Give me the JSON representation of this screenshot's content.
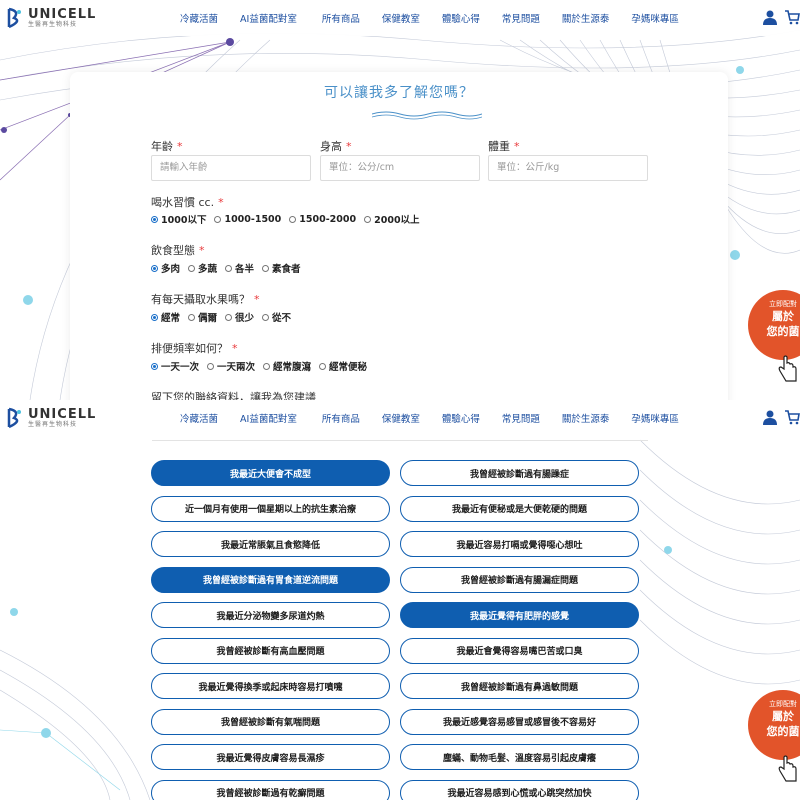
{
  "header": {
    "logo_name": "UNICELL",
    "logo_sub": "生醫再生物科技",
    "nav": [
      "冷藏活菌",
      "AI益菌配對室",
      "所有商品",
      "保健教室",
      "體驗心得",
      "常見問題",
      "關於生源泰",
      "孕媽咪專區"
    ]
  },
  "form": {
    "title": "可以讓我多了解您嗎？",
    "age_label": "年齡",
    "age_placeholder": "請輸入年齡",
    "height_label": "身高",
    "height_placeholder": "單位：公分/cm",
    "weight_label": "體重",
    "weight_placeholder": "單位：公斤/kg",
    "water_label": "喝水習慣 cc.",
    "water_options": [
      "1000以下",
      "1000-1500",
      "1500-2000",
      "2000以上"
    ],
    "water_selected": 0,
    "diet_label": "飲食型態",
    "diet_options": [
      "多肉",
      "多蔬",
      "各半",
      "素食者"
    ],
    "diet_selected": 0,
    "fruit_label": "有每天攝取水果嗎？",
    "fruit_options": [
      "經常",
      "偶爾",
      "很少",
      "從不"
    ],
    "fruit_selected": 0,
    "bowel_label": "排便頻率如何？",
    "bowel_options": [
      "一天一次",
      "一天兩次",
      "經常腹瀉",
      "經常便秘"
    ],
    "bowel_selected": 0,
    "contact_label": "留下您的聯絡資料，讓我為您建議",
    "required_mark": "*"
  },
  "symptoms": [
    {
      "label": "我最近大便會不成型",
      "selected": true
    },
    {
      "label": "我曾經被診斷過有腸躁症",
      "selected": false
    },
    {
      "label": "近一個月有使用一個星期以上的抗生素治療",
      "selected": false
    },
    {
      "label": "我最近有便秘或是大便乾硬的問題",
      "selected": false
    },
    {
      "label": "我最近常脹氣且食慾降低",
      "selected": false
    },
    {
      "label": "我最近容易打嗝或覺得噁心想吐",
      "selected": false
    },
    {
      "label": "我曾經被診斷過有胃食道逆流問題",
      "selected": true
    },
    {
      "label": "我曾經被診斷過有腸漏症問題",
      "selected": false
    },
    {
      "label": "我最近分泌物變多尿道灼熱",
      "selected": false
    },
    {
      "label": "我最近覺得有肥胖的感覺",
      "selected": true
    },
    {
      "label": "我曾經被診斷有高血壓問題",
      "selected": false
    },
    {
      "label": "我最近會覺得容易嘴巴苦或口臭",
      "selected": false
    },
    {
      "label": "我最近覺得換季或起床時容易打噴嚏",
      "selected": false
    },
    {
      "label": "我曾經被診斷過有鼻過敏問題",
      "selected": false
    },
    {
      "label": "我曾經被診斷有氣喘問題",
      "selected": false
    },
    {
      "label": "我最近感覺容易感冒或感冒後不容易好",
      "selected": false
    },
    {
      "label": "我最近覺得皮膚容易長濕疹",
      "selected": false
    },
    {
      "label": "塵蟎、動物毛髮、溫度容易引起皮膚癢",
      "selected": false
    },
    {
      "label": "我曾經被診斷過有乾癬問題",
      "selected": false
    },
    {
      "label": "我最近容易感到心慌或心跳突然加快",
      "selected": false
    }
  ],
  "badge": {
    "small": "立即配對",
    "line1": "屬於",
    "line2": "您的菌"
  },
  "colors": {
    "primary": "#0f5eb0",
    "nav": "#1d4fa0",
    "title": "#4a90c8",
    "required": "#e8393b",
    "badge": "#e2542a"
  }
}
